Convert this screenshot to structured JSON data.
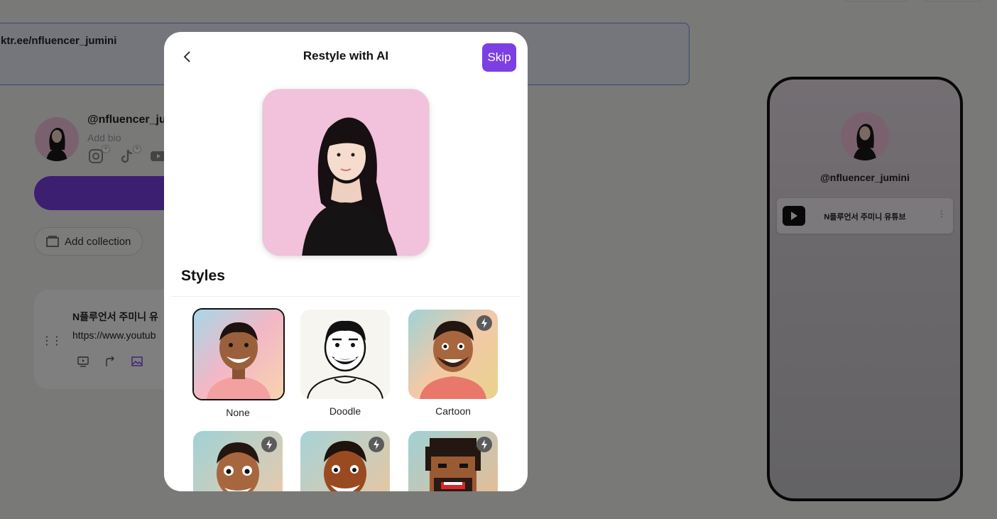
{
  "background": {
    "url_text": "ktr.ee/nfluencer_jumini",
    "profile": {
      "handle": "@nfluencer_ju",
      "bio_placeholder": "Add bio",
      "socials": [
        "instagram-icon",
        "tiktok-icon",
        "youtube-icon"
      ]
    },
    "add_collection_label": "Add collection",
    "link_card": {
      "title": "N플루언서 주미니 유",
      "url": "https://www.youtub"
    },
    "phone_preview": {
      "handle": "@nfluencer_jumini",
      "link_title": "N플루언서 주미니 유튜브",
      "more": "⋮"
    }
  },
  "modal": {
    "title": "Restyle with AI",
    "skip_label": "Skip",
    "styles_heading": "Styles",
    "styles": [
      {
        "label": "None",
        "selected": true,
        "premium": false
      },
      {
        "label": "Doodle",
        "selected": false,
        "premium": false
      },
      {
        "label": "Cartoon",
        "selected": false,
        "premium": true
      },
      {
        "label": "",
        "selected": false,
        "premium": true
      },
      {
        "label": "",
        "selected": false,
        "premium": true
      },
      {
        "label": "",
        "selected": false,
        "premium": true
      }
    ]
  },
  "colors": {
    "accent": "#7c3fe4",
    "overlay": "#000000",
    "avatar_bg": "#f2c3dc"
  }
}
